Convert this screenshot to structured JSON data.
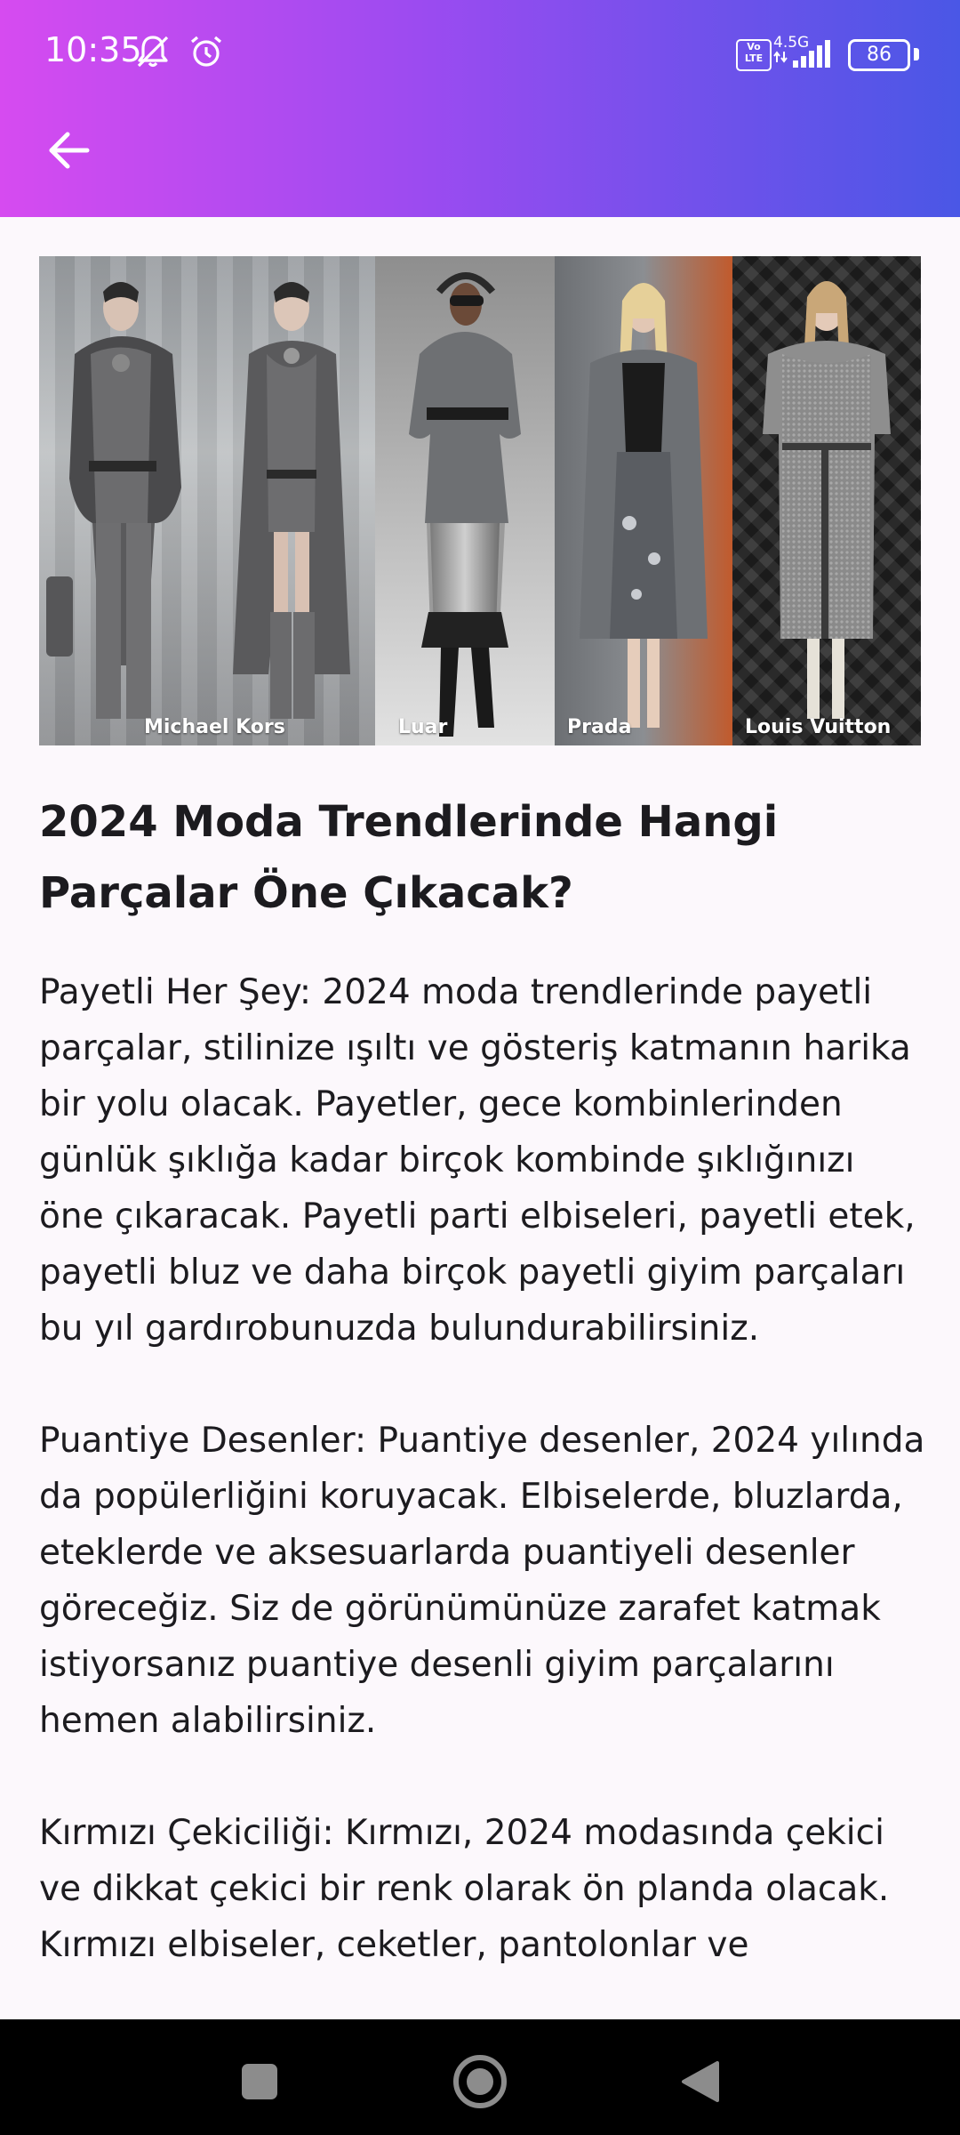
{
  "status_bar": {
    "time": "10:35",
    "network_label": "4.5G",
    "volte_label": "Vo LTE",
    "battery_level": "86"
  },
  "toolbar": {
    "back_icon": "arrow-left-icon"
  },
  "hero_image": {
    "looks": [
      {
        "label": "Michael Kors"
      },
      {
        "label": ""
      },
      {
        "label": "Luar"
      },
      {
        "label": "Prada"
      },
      {
        "label": "Louis Vuitton"
      }
    ]
  },
  "article": {
    "title": "2024 Moda Trendlerinde Hangi Parçalar Öne Çıkacak?",
    "paragraphs": [
      "Payetli Her Şey: 2024 moda trendlerinde payetli parçalar, stilinize ışıltı ve gösteriş katmanın harika bir yolu olacak. Payetler, gece kombinlerinden günlük şıklığa kadar birçok kombinde şıklığınızı öne çıkaracak. Payetli parti elbiseleri, payetli etek, payetli bluz ve daha birçok payetli giyim parçaları bu yıl gardırobunuzda bulundurabilirsiniz.",
      "Puantiye Desenler: Puantiye desenler, 2024 yılında da popülerliğini koruyacak. Elbiselerde, bluzlarda, eteklerde ve aksesuarlarda puantiyeli desenler göreceğiz. Siz de görünümünüze zarafet katmak istiyorsanız puantiye desenli giyim parçalarını hemen alabilirsiniz.",
      "Kırmızı Çekiciliği: Kırmızı, 2024 modasında çekici ve dikkat çekici bir renk olarak ön planda olacak. Kırmızı elbiseler, ceketler, pantolonlar ve"
    ]
  },
  "nav_bar": {
    "recent_icon": "square-icon",
    "home_icon": "circle-home-icon",
    "back_icon": "triangle-back-icon"
  }
}
